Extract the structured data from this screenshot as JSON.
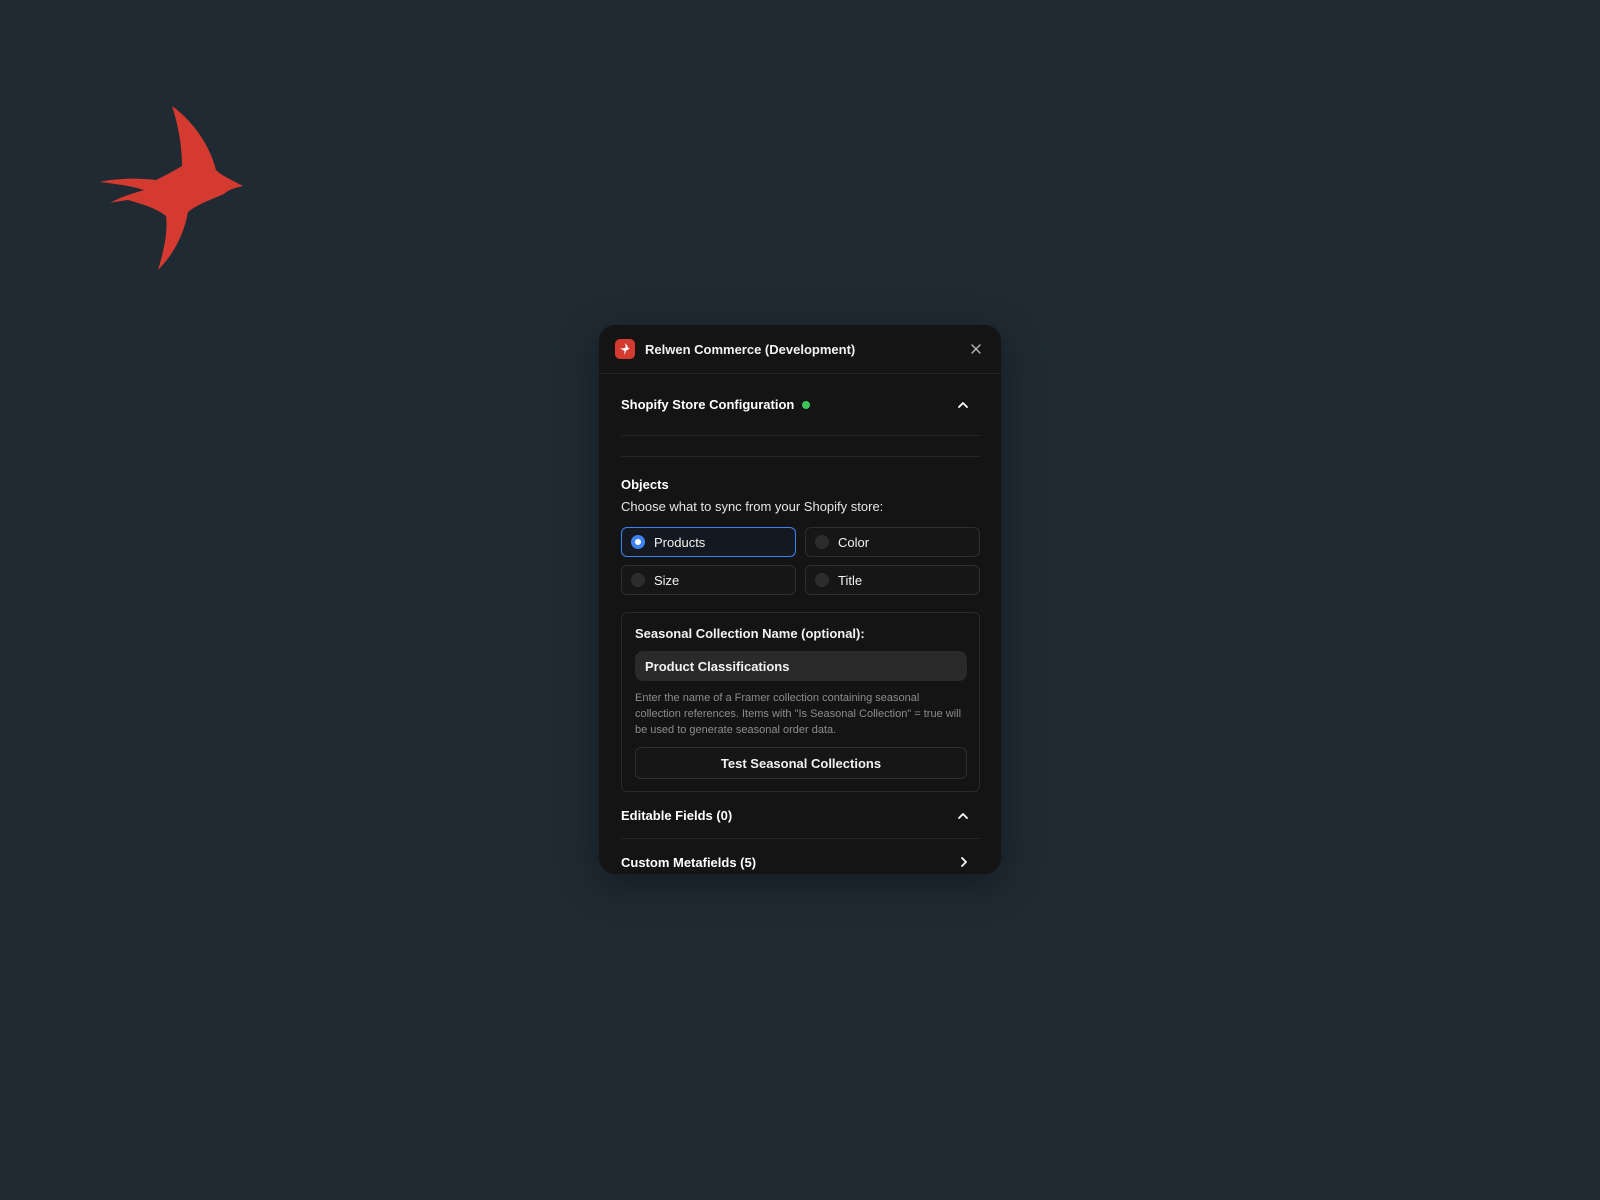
{
  "window": {
    "title": "Relwen Commerce (Development)",
    "close_icon": "close-icon",
    "app_icon": "swallow-icon"
  },
  "colors": {
    "background": "#1f2a33",
    "panel": "#141414",
    "brand_red": "#d43a30",
    "accent_blue": "#3d82f0",
    "status_green": "#3ec55a"
  },
  "store_config": {
    "title": "Shopify Store Configuration",
    "status": "connected",
    "expanded": true
  },
  "objects": {
    "label": "Objects",
    "description": "Choose what to sync from your Shopify store:",
    "options": [
      {
        "label": "Products",
        "selected": true
      },
      {
        "label": "Color",
        "selected": false
      },
      {
        "label": "Size",
        "selected": false
      },
      {
        "label": "Title",
        "selected": false
      }
    ]
  },
  "seasonal": {
    "label": "Seasonal Collection Name (optional):",
    "value": "Product Classifications",
    "help": "Enter the name of a Framer collection containing seasonal collection references. Items with \"Is Seasonal Collection\" = true will be used to generate seasonal order data.",
    "button_label": "Test Seasonal Collections"
  },
  "editable_fields": {
    "title": "Editable Fields (0)",
    "expanded": true
  },
  "custom_metafields": {
    "title": "Custom Metafields (5)",
    "expanded": false
  }
}
